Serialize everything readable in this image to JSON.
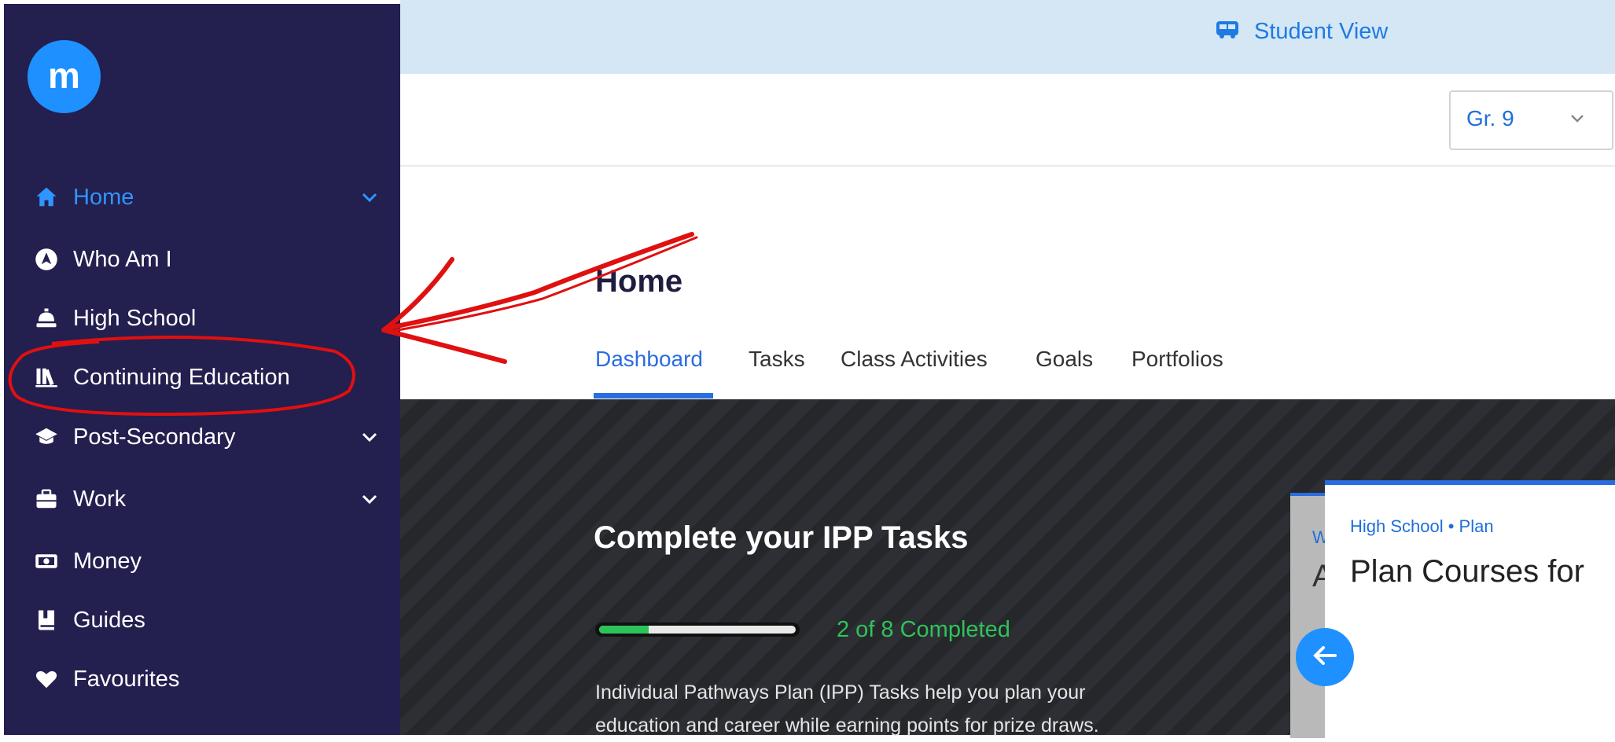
{
  "logo_text": "m",
  "sidebar": {
    "items": [
      {
        "label": "Home",
        "icon": "home-icon",
        "active": true,
        "expandable": true
      },
      {
        "label": "Who Am I",
        "icon": "compass-icon",
        "active": false,
        "expandable": false
      },
      {
        "label": "High School",
        "icon": "bell-icon",
        "active": false,
        "expandable": false
      },
      {
        "label": "Continuing Education",
        "icon": "library-icon",
        "active": false,
        "expandable": false
      },
      {
        "label": "Post-Secondary",
        "icon": "graduation-cap-icon",
        "active": false,
        "expandable": true
      },
      {
        "label": "Work",
        "icon": "briefcase-icon",
        "active": false,
        "expandable": true
      },
      {
        "label": "Money",
        "icon": "money-icon",
        "active": false,
        "expandable": false
      },
      {
        "label": "Guides",
        "icon": "book-icon",
        "active": false,
        "expandable": false
      },
      {
        "label": "Favourites",
        "icon": "heart-icon",
        "active": false,
        "expandable": false
      }
    ]
  },
  "banner": {
    "label": "Student View",
    "icon": "bus-icon"
  },
  "grade_select": {
    "value": "Gr. 9"
  },
  "page": {
    "title": "Home",
    "tabs": [
      {
        "label": "Dashboard",
        "active": true
      },
      {
        "label": "Tasks",
        "active": false
      },
      {
        "label": "Class Activities",
        "active": false
      },
      {
        "label": "Goals",
        "active": false
      },
      {
        "label": "Portfolios",
        "active": false
      }
    ]
  },
  "ipp": {
    "title": "Complete your IPP Tasks",
    "progress_fraction": 0.25,
    "progress_text": "2 of 8 Completed",
    "description": "Individual Pathways Plan (IPP) Tasks help you plan your education and career while earning points for prize draws."
  },
  "card_back": {
    "peek_small": "W",
    "peek_big": "A"
  },
  "card": {
    "crumb": "High School • Plan",
    "title": "Plan Courses for"
  },
  "colors": {
    "sidebar_bg": "#231f4f",
    "accent": "#1e90ff",
    "tab_active": "#2a6de0",
    "progress": "#2ec35a",
    "annotation": "#e01010"
  }
}
